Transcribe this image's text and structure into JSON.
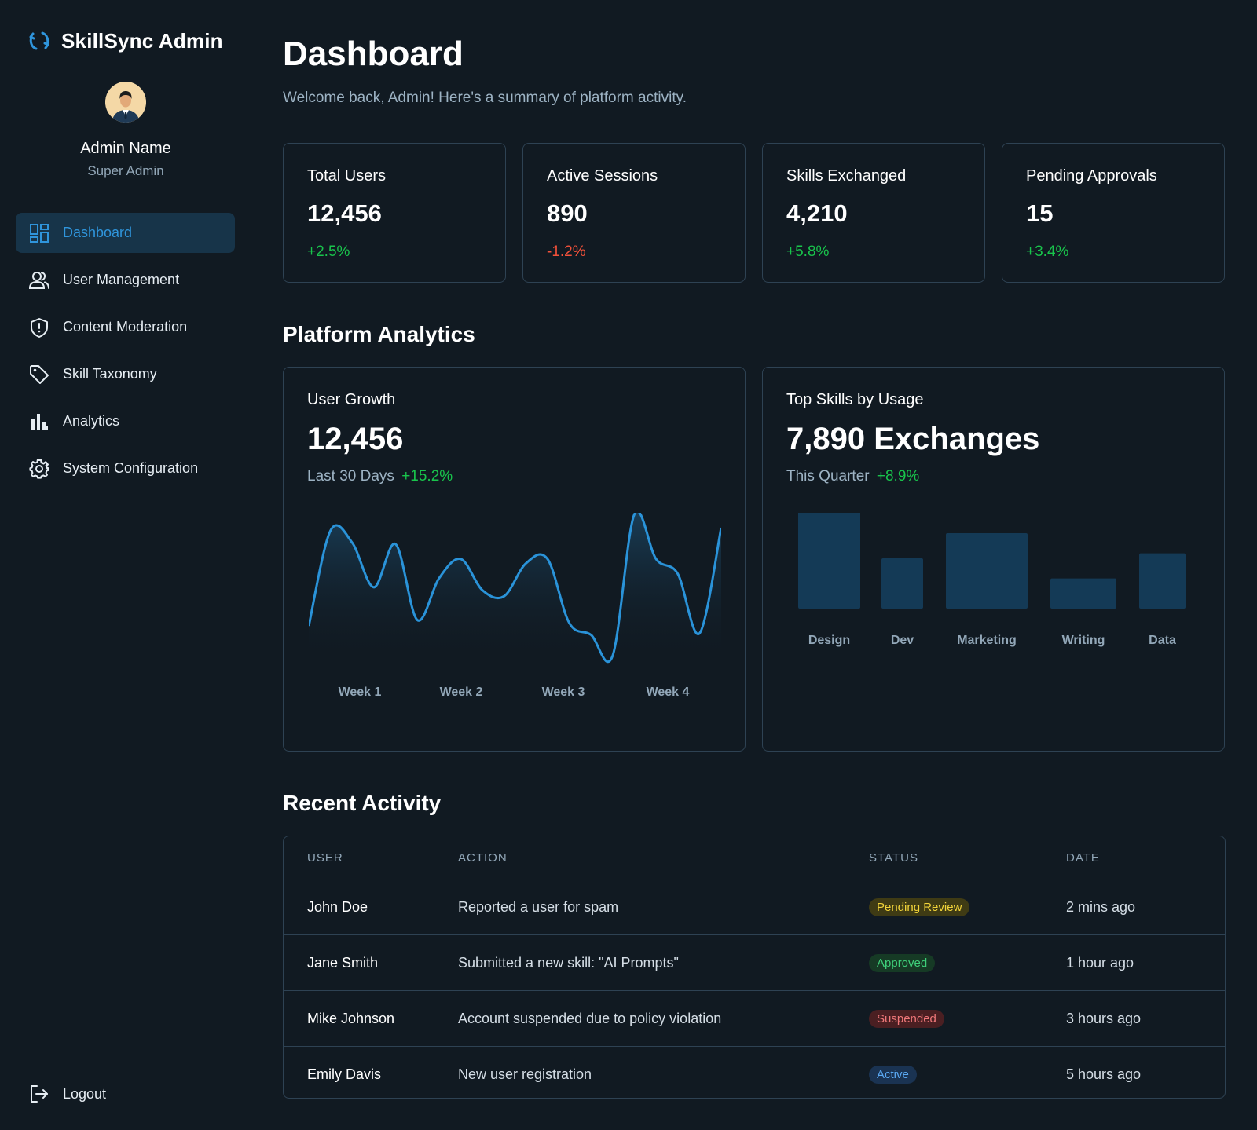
{
  "app": {
    "title": "SkillSync Admin"
  },
  "profile": {
    "name": "Admin Name",
    "role": "Super Admin"
  },
  "sidebar": {
    "items": [
      {
        "label": "Dashboard",
        "icon": "dashboard-icon",
        "active": true
      },
      {
        "label": "User Management",
        "icon": "users-icon"
      },
      {
        "label": "Content Moderation",
        "icon": "shield-icon"
      },
      {
        "label": "Skill Taxonomy",
        "icon": "tag-icon"
      },
      {
        "label": "Analytics",
        "icon": "bar-chart-icon"
      },
      {
        "label": "System Configuration",
        "icon": "gear-icon"
      }
    ],
    "logout": "Logout"
  },
  "header": {
    "title": "Dashboard",
    "subtitle": "Welcome back, Admin! Here's a summary of platform activity."
  },
  "stats": [
    {
      "label": "Total Users",
      "value": "12,456",
      "delta": "+2.5%"
    },
    {
      "label": "Active Sessions",
      "value": "890",
      "delta": "-1.2%"
    },
    {
      "label": "Skills Exchanged",
      "value": "4,210",
      "delta": "+5.8%"
    },
    {
      "label": "Pending Approvals",
      "value": "15",
      "delta": "+3.4%"
    }
  ],
  "analytics": {
    "title": "Platform Analytics",
    "user_growth": {
      "label": "User Growth",
      "value": "12,456",
      "period": "Last 30 Days",
      "delta": "+15.2%"
    },
    "top_skills": {
      "label": "Top Skills by Usage",
      "value": "7,890 Exchanges",
      "period": "This Quarter",
      "delta": "+8.9%"
    }
  },
  "chart_data": [
    {
      "type": "area",
      "title": "User Growth",
      "categories": [
        "Week 1",
        "Week 2",
        "Week 3",
        "Week 4"
      ],
      "series": [
        {
          "values": [
            20,
            84,
            76,
            46,
            75,
            24,
            52,
            65,
            44,
            40,
            62,
            65,
            22,
            14,
            0,
            95,
            65,
            55,
            15,
            86
          ]
        }
      ],
      "color": "#2a93d9"
    },
    {
      "type": "bar",
      "title": "Top Skills by Usage",
      "categories": [
        "Design",
        "Dev",
        "Marketing",
        "Writing",
        "Data"
      ],
      "values": [
        100,
        50,
        75,
        30,
        55
      ],
      "color": "#143a56"
    }
  ],
  "activity": {
    "title": "Recent Activity",
    "columns": [
      "USER",
      "ACTION",
      "STATUS",
      "DATE"
    ],
    "rows": [
      {
        "user": "John Doe",
        "action": "Reported a user for spam",
        "status": "Pending Review",
        "date": "2 mins ago"
      },
      {
        "user": "Jane Smith",
        "action": "Submitted a new skill: \"AI Prompts\"",
        "status": "Approved",
        "date": "1 hour ago"
      },
      {
        "user": "Mike Johnson",
        "action": "Account suspended due to policy violation",
        "status": "Suspended",
        "date": "3 hours ago"
      },
      {
        "user": "Emily Davis",
        "action": "New user registration",
        "status": "Active",
        "date": "5 hours ago"
      }
    ]
  }
}
